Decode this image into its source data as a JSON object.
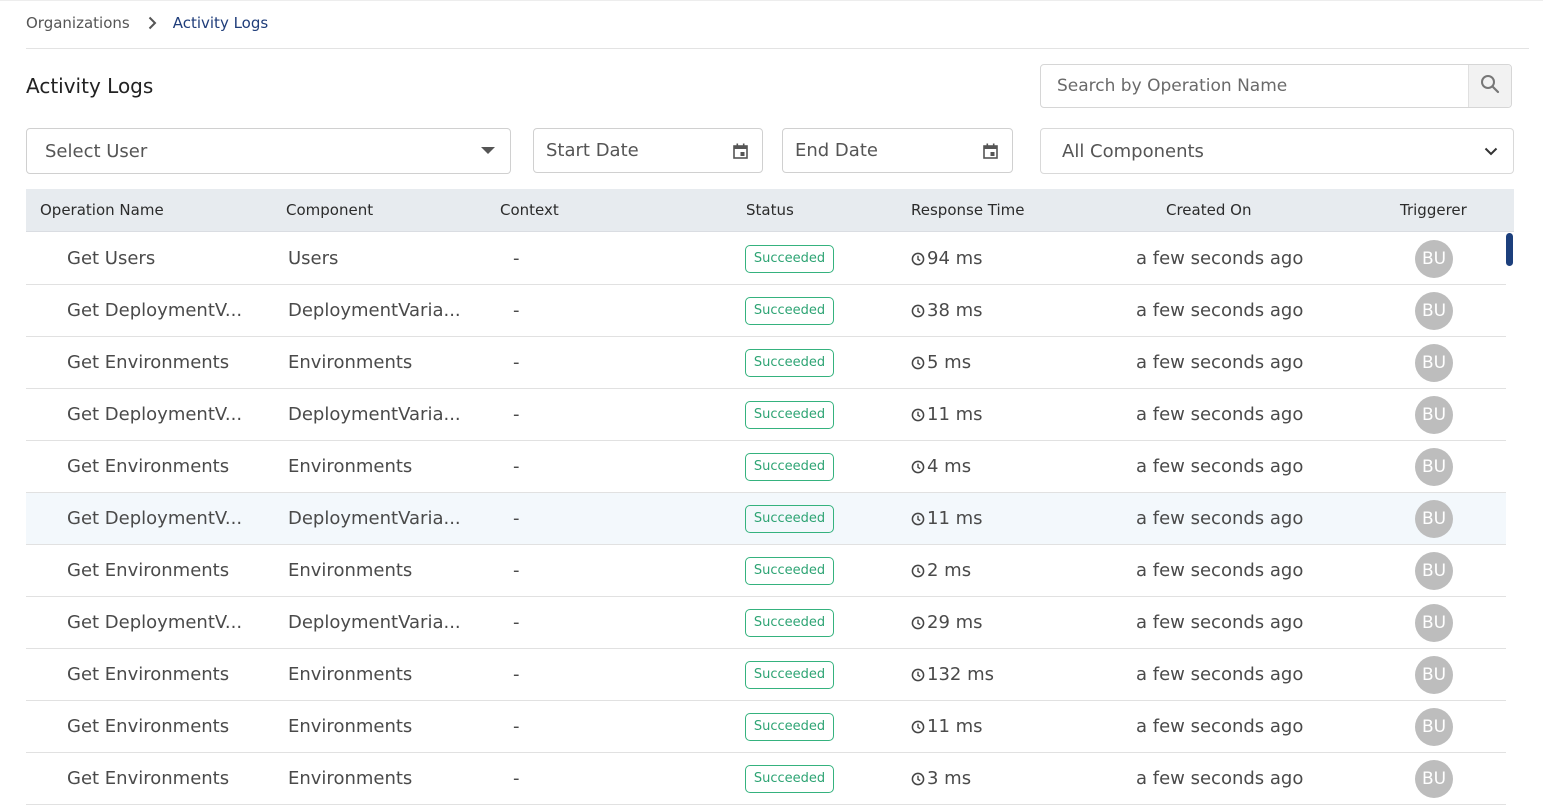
{
  "breadcrumb": {
    "root": "Organizations",
    "current": "Activity Logs"
  },
  "page": {
    "title": "Activity Logs"
  },
  "search": {
    "placeholder": "Search by Operation Name",
    "icon": "search-icon"
  },
  "filters": {
    "user": {
      "label": "Select User",
      "icon": "caret-down-icon"
    },
    "start_date": {
      "label": "Start Date",
      "icon": "calendar-icon"
    },
    "end_date": {
      "label": "End Date",
      "icon": "calendar-icon"
    },
    "component": {
      "label": "All Components",
      "icon": "chevron-down-icon"
    }
  },
  "table": {
    "columns": [
      "Operation Name",
      "Component",
      "Context",
      "Status",
      "Response Time",
      "Created On",
      "Triggerer"
    ],
    "rows": [
      {
        "operation": "Get Users",
        "component": "Users",
        "context": "-",
        "status": "Succeeded",
        "response_time": "94 ms",
        "created_on": "a few seconds ago",
        "triggerer": "BU"
      },
      {
        "operation": "Get DeploymentV...",
        "component": "DeploymentVaria...",
        "context": "-",
        "status": "Succeeded",
        "response_time": "38 ms",
        "created_on": "a few seconds ago",
        "triggerer": "BU"
      },
      {
        "operation": "Get Environments",
        "component": "Environments",
        "context": "-",
        "status": "Succeeded",
        "response_time": "5 ms",
        "created_on": "a few seconds ago",
        "triggerer": "BU"
      },
      {
        "operation": "Get DeploymentV...",
        "component": "DeploymentVaria...",
        "context": "-",
        "status": "Succeeded",
        "response_time": "11 ms",
        "created_on": "a few seconds ago",
        "triggerer": "BU"
      },
      {
        "operation": "Get Environments",
        "component": "Environments",
        "context": "-",
        "status": "Succeeded",
        "response_time": "4 ms",
        "created_on": "a few seconds ago",
        "triggerer": "BU"
      },
      {
        "operation": "Get DeploymentV...",
        "component": "DeploymentVaria...",
        "context": "-",
        "status": "Succeeded",
        "response_time": "11 ms",
        "created_on": "a few seconds ago",
        "triggerer": "BU"
      },
      {
        "operation": "Get Environments",
        "component": "Environments",
        "context": "-",
        "status": "Succeeded",
        "response_time": "2 ms",
        "created_on": "a few seconds ago",
        "triggerer": "BU"
      },
      {
        "operation": "Get DeploymentV...",
        "component": "DeploymentVaria...",
        "context": "-",
        "status": "Succeeded",
        "response_time": "29 ms",
        "created_on": "a few seconds ago",
        "triggerer": "BU"
      },
      {
        "operation": "Get Environments",
        "component": "Environments",
        "context": "-",
        "status": "Succeeded",
        "response_time": "132 ms",
        "created_on": "a few seconds ago",
        "triggerer": "BU"
      },
      {
        "operation": "Get Environments",
        "component": "Environments",
        "context": "-",
        "status": "Succeeded",
        "response_time": "11 ms",
        "created_on": "a few seconds ago",
        "triggerer": "BU"
      },
      {
        "operation": "Get Environments",
        "component": "Environments",
        "context": "-",
        "status": "Succeeded",
        "response_time": "3 ms",
        "created_on": "a few seconds ago",
        "triggerer": "BU"
      }
    ],
    "status_color": "#35b27e",
    "header_bg": "#e7ebef",
    "highlighted_row_index": 5
  },
  "colors": {
    "accent": "#1f3d7a",
    "avatar_bg": "#bdbdbd"
  }
}
